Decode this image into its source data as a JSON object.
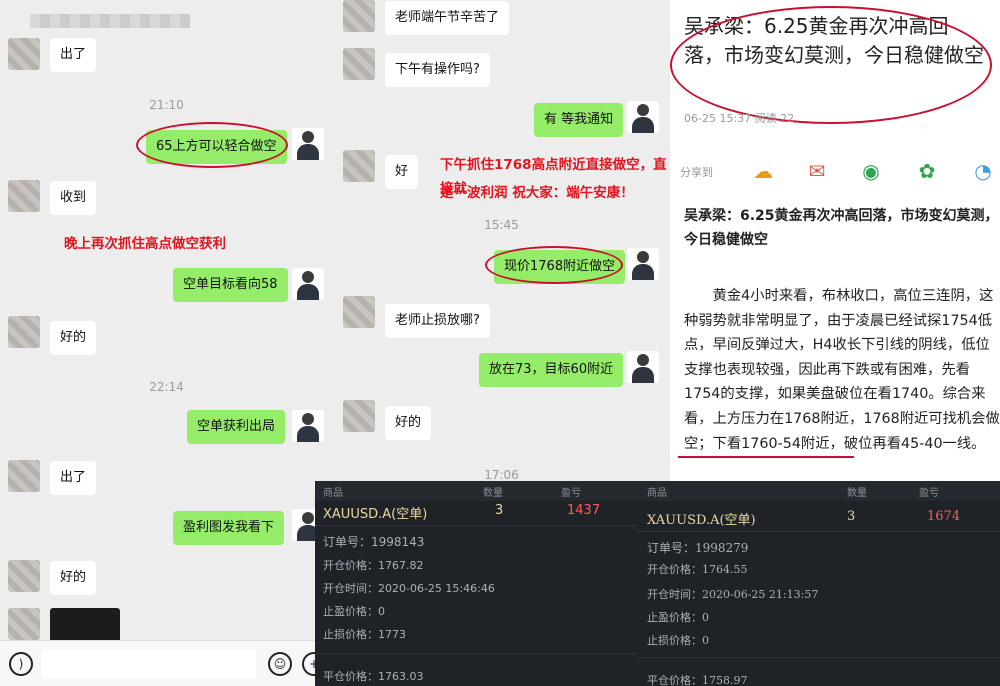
{
  "chat1": {
    "ts1": "21:10",
    "ts2": "22:14",
    "msgs": [
      "出了",
      "65上方可以轻合做空",
      "收到",
      "空单目标看向58",
      "好的",
      "空单获利出局",
      "出了",
      "盈利图发我看下",
      "好的"
    ],
    "annotation": "晚上再次抓住高点做空获利"
  },
  "chat2": {
    "ts1": "15:45",
    "ts2": "17:06",
    "msgs": [
      "老师端午节辛苦了",
      "下午有操作吗?",
      "有 等我通知",
      "好",
      "现价1768附近做空",
      "老师止损放哪?",
      "放在73，目标60附近",
      "好的"
    ],
    "annotation_line1": "下午抓住1768高点附近直接做空，直接就",
    "annotation_line2": "是一波利润   祝大家：端午安康！"
  },
  "article": {
    "title": "吴承梁：6.25黄金再次冲高回落，市场变幻莫测，今日稳健做空",
    "meta": "06-25 15:37  阅读 22",
    "share_label": "分享到",
    "subtitle": "吴承梁：6.25黄金再次冲高回落，市场变幻莫测，今日稳健做空",
    "body": "黄金4小时来看，布林收口，高位三连阴，这种弱势就非常明显了，由于凌晨已经试探1754低点，早间反弹过大，H4收长下引线的阴线，低位支撑也表现较强，因此再下跌或有困难，先看1754的支撑，如果美盘破位在看1740。综合来看，上方压力在1768附近，1768附近可找机会做空；下看1760-54附近，破位再看45-40一线。"
  },
  "trade1": {
    "h_product": "商品",
    "h_qty": "数量",
    "h_pnl": "盈亏",
    "symbol": "XAUUSD.A(空单)",
    "qty": "3",
    "pnl": "1437",
    "order": "订单号：1998143",
    "open_price": "开仓价格：1767.82",
    "open_time": "开仓时间：2020-06-25 15:46:46",
    "tp": "止盈价格：0",
    "sl": "止损价格：1773",
    "close_price": "平仓价格：1763.03"
  },
  "trade2": {
    "h_product": "商品",
    "h_qty": "数量",
    "h_pnl": "盈亏",
    "symbol": "XAUUSD.A(空单)",
    "qty": "3",
    "pnl": "1674",
    "order": "订单号：1998279",
    "open_price": "开仓价格：1764.55",
    "open_time": "开仓时间：2020-06-25 21:13:57",
    "tp": "止盈价格：0",
    "sl": "止损价格：0",
    "close_price": "平仓价格：1758.97"
  },
  "icons": [
    "voice-icon",
    "emoji-icon",
    "plus-icon",
    "weibo-icon",
    "mail-icon",
    "wechat-icon",
    "moments-icon",
    "qq-icon"
  ],
  "colors": {
    "accent_red": "#e0151f",
    "wechat_green": "#95ec69",
    "dark_card": "#1f2328"
  }
}
